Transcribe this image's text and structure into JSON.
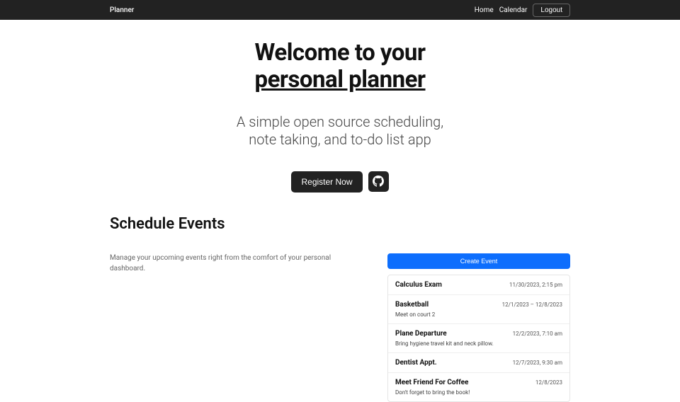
{
  "navbar": {
    "brand": "Planner",
    "links": [
      {
        "label": "Home"
      },
      {
        "label": "Calendar"
      }
    ],
    "logout": "Logout"
  },
  "hero": {
    "title_line1": "Welcome to your",
    "title_line2": "personal planner",
    "subtitle_line1": "A simple open source scheduling,",
    "subtitle_line2": "note taking, and to-do list app",
    "register_btn": "Register Now"
  },
  "schedule": {
    "title": "Schedule Events",
    "description": "Manage your upcoming events right from the comfort of your personal dashboard.",
    "create_btn": "Create Event",
    "events": [
      {
        "title": "Calculus Exam",
        "date": "11/30/2023, 2:15 pm",
        "note": ""
      },
      {
        "title": "Basketball",
        "date": "12/1/2023 – 12/8/2023",
        "note": "Meet on court 2"
      },
      {
        "title": "Plane Departure",
        "date": "12/2/2023, 7:10 am",
        "note": "Bring hygiene travel kit and neck pillow."
      },
      {
        "title": "Dentist Appt.",
        "date": "12/7/2023, 9:30 am",
        "note": ""
      },
      {
        "title": "Meet Friend For Coffee",
        "date": "12/8/2023",
        "note": "Don't forget to bring the book!"
      }
    ]
  }
}
